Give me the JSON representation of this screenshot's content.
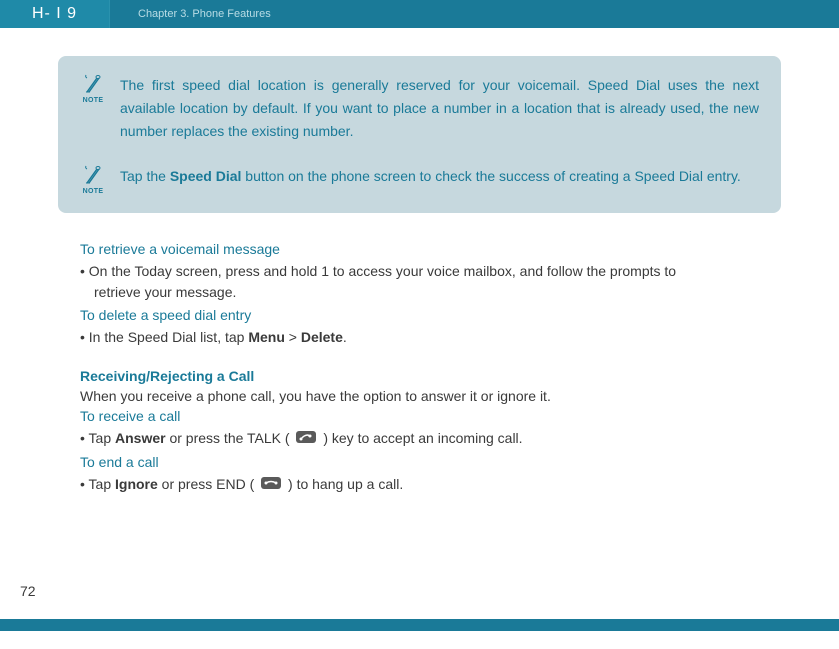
{
  "header": {
    "logo": "H- I 9",
    "chapter": "Chapter 3. Phone Features"
  },
  "notes": {
    "note1": "The first speed dial location is generally reserved for your voicemail. Speed Dial uses the next available location by default. If you want to place a number in a location that is already used, the new number replaces the existing number.",
    "note2_pre": "Tap the ",
    "note2_bold": "Speed Dial",
    "note2_post": " button on the phone screen to check the success of creating a Speed Dial entry.",
    "note_label": "NOTE"
  },
  "body": {
    "retrieve_heading": "To retrieve a voicemail message",
    "retrieve_bullet_line1": "• On the Today screen, press and hold 1 to access your voice mailbox, and follow the prompts to",
    "retrieve_bullet_line2": "retrieve your message.",
    "delete_heading": "To delete a speed dial entry",
    "delete_bullet_pre": "• In the Speed Dial list, tap ",
    "delete_menu": "Menu",
    "delete_gt": " > ",
    "delete_delete": "Delete",
    "delete_period": ".",
    "receiving_heading": "Receiving/Rejecting a Call",
    "receiving_text": "When you receive a phone call, you have the option to answer it or ignore it.",
    "receive_call_heading": "To receive a call",
    "receive_bullet_pre": "• Tap ",
    "receive_answer": "Answer",
    "receive_mid": " or press the TALK ( ",
    "receive_post": " ) key to accept an incoming call.",
    "end_call_heading": "To end a call",
    "end_bullet_pre": "• Tap ",
    "end_ignore": "Ignore",
    "end_mid": " or press END ( ",
    "end_post": " ) to hang up a call."
  },
  "page_number": "72"
}
